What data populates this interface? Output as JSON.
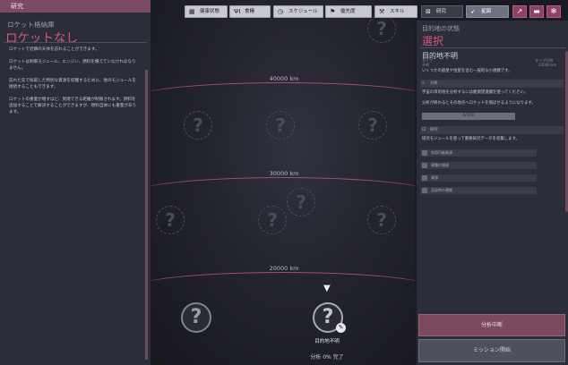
{
  "left": {
    "header": "研究",
    "subtitle": "ロケット格納庫",
    "title": "ロケットなし",
    "paragraphs": [
      "ロケットで近隣の天体を訪れることができます。",
      "ロケットは制御モジュール、エンジン、燃料を備えていなければなりません。",
      "訪れた先で採取した特別な資源を収穫するために、他のモジュールを接続することもできます。",
      "ロケットの重量が増すほど、到達できる距離が制限されます。燃料を追加することで解決することができますが、燃料自体にも重量があります。"
    ]
  },
  "toolbar": {
    "vitals": "健康状態",
    "food": "食糧",
    "schedule": "スケジュール",
    "priorities": "優先度",
    "skills": "スキル",
    "research": "研究",
    "starmap": "星図"
  },
  "map": {
    "distances": [
      "40000 km",
      "30000 km",
      "20000 km"
    ],
    "unknown_glyph": "?",
    "pointer_glyph": "▼",
    "target_label": "目的地不明",
    "analysis_progress": "分析 0% 完了"
  },
  "right": {
    "subtitle": "目的地の状態",
    "title": "選択",
    "name": "目的地不明",
    "type_label": "タイプ",
    "type_value": "不明",
    "distance_label": "タイプ不明",
    "distance_value": "10000 km",
    "description": "いくつかの惑星や恒星を含む一般的な小規模です。",
    "analysis_section": "分析",
    "analysis_text_1": "宇宙の目的地を分析するには観測望遠鏡を使ってください。",
    "analysis_text_2": "分析が終わるとその地点へロケットを飛ばせるようになります。",
    "progress_text": "0/100",
    "progress_fraction": 0,
    "research_section": "研究",
    "research_text": "研究モジュールを使って重要研究データを収集します。",
    "items": [
      "利用可能資源",
      "現場の調達",
      "資源",
      "回収時の運搬"
    ],
    "stop_button": "分析中断",
    "launch_button": "ミッション開始"
  },
  "colors": {
    "accent": "#d7577f",
    "header_bg": "#7c4a63",
    "panel_bg": "#2b2d38",
    "distance_line": "#a64d75"
  }
}
